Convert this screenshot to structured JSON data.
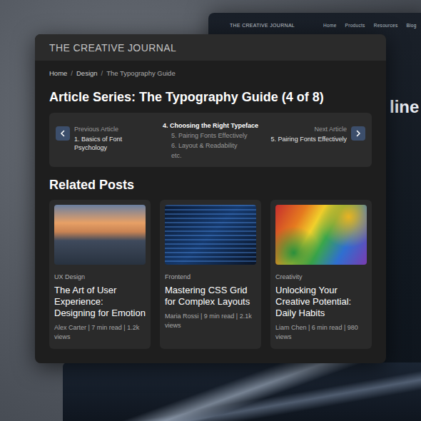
{
  "background_window": {
    "title": "THE CREATIVE JOURNAL",
    "nav": [
      "Home",
      "Products",
      "Resources",
      "Blog"
    ],
    "hero_text": "line"
  },
  "window": {
    "title": "THE CREATIVE JOURNAL"
  },
  "breadcrumb": {
    "separator": "/",
    "items": [
      "Home",
      "Design",
      "The Typography Guide"
    ]
  },
  "series": {
    "title": "Article Series: The Typography Guide (4 of 8)",
    "previous": {
      "label": "Previous Article",
      "title": "1. Basics of Font Psychology"
    },
    "next": {
      "label": "Next Article",
      "title": "5. Pairing Fonts Effectively"
    },
    "items": [
      {
        "label": "4. Choosing the Right Typeface",
        "selected": true
      },
      {
        "label": "5. Pairing Fonts Effectively",
        "selected": false
      },
      {
        "label": "6. Layout & Readability",
        "selected": false
      },
      {
        "label": "etc.",
        "selected": false
      }
    ]
  },
  "related": {
    "title": "Related Posts",
    "posts": [
      {
        "category": "UX Design",
        "title": "The Art of User Experience: Designing for Emotion",
        "meta": "Alex Carter | 7 min read | 1.2k views"
      },
      {
        "category": "Frontend",
        "title": "Mastering CSS Grid for Complex Layouts",
        "meta": "Maria Rossi | 9 min read | 2.1k views"
      },
      {
        "category": "Creativity",
        "title": "Unlocking Your Creative Potential: Daily Habits",
        "meta": "Liam Chen | 6 min read | 980 views"
      }
    ]
  }
}
